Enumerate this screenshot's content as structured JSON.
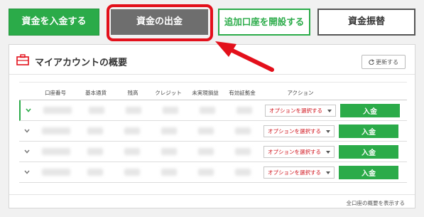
{
  "buttons": {
    "deposit": "資金を入金する",
    "withdraw": "資金の出金",
    "open_account": "追加口座を開設する",
    "transfer": "資金振替"
  },
  "panel": {
    "title": "マイアカウントの概要",
    "refresh_label": "更新する",
    "show_all": "全口座の概要を表示する"
  },
  "table": {
    "headers": [
      "口座番号",
      "基本通貨",
      "残高",
      "クレジット",
      "未実現損益",
      "有効証拠金",
      "アクション"
    ],
    "rows": [
      {
        "action_select": "オプションを選択する",
        "deposit_label": "入金"
      },
      {
        "action_select": "オプションを選択する",
        "deposit_label": "入金"
      },
      {
        "action_select": "オプションを選択する",
        "deposit_label": "入金"
      },
      {
        "action_select": "オプションを選択する",
        "deposit_label": "入金"
      }
    ]
  },
  "colors": {
    "brand_green": "#2bab49",
    "highlight_red": "#e3101b",
    "withdraw_gray": "#6e6e6e"
  }
}
